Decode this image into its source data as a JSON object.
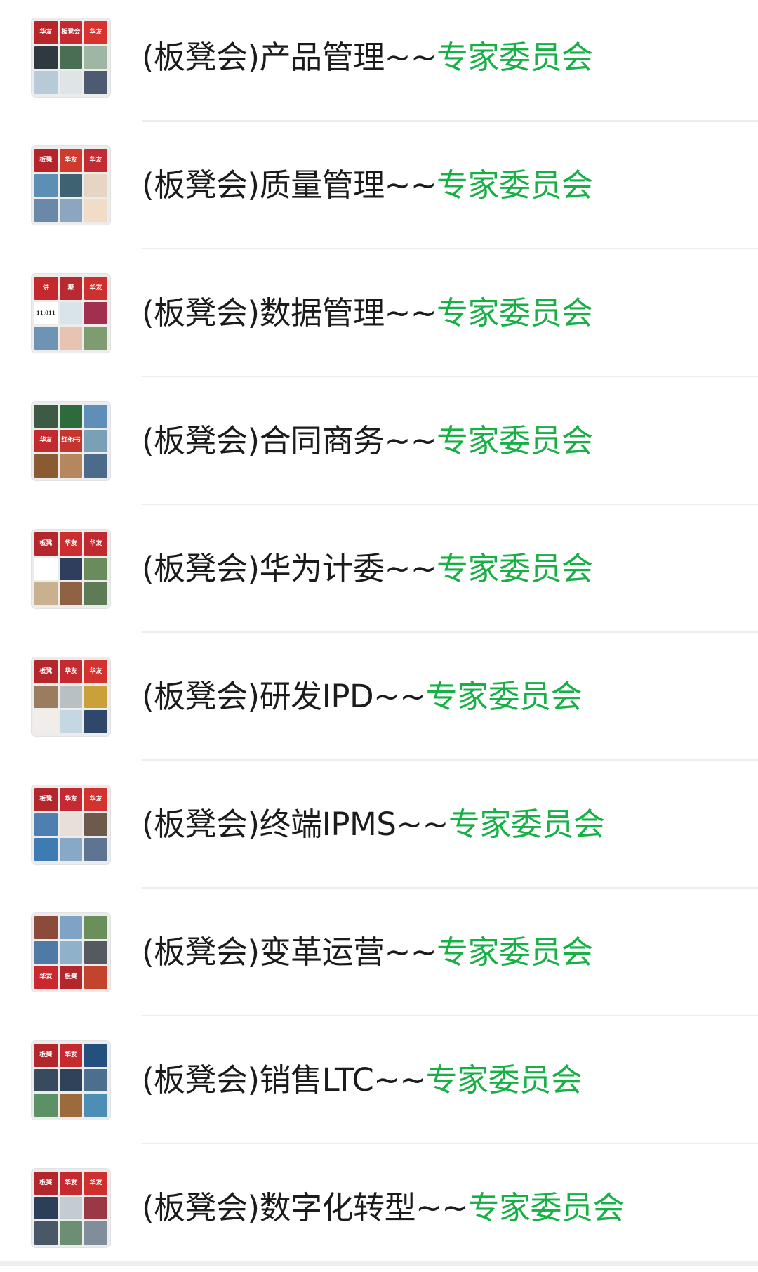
{
  "groups": [
    {
      "prefix": "(板凳会)产品管理~~",
      "suffix": "专家委员会"
    },
    {
      "prefix": "(板凳会)质量管理~~",
      "suffix": "专家委员会"
    },
    {
      "prefix": "(板凳会)数据管理~~",
      "suffix": "专家委员会"
    },
    {
      "prefix": "(板凳会)合同商务~~",
      "suffix": "专家委员会"
    },
    {
      "prefix": "(板凳会)华为计委~~",
      "suffix": "专家委员会"
    },
    {
      "prefix": "(板凳会)研发IPD~~",
      "suffix": "专家委员会"
    },
    {
      "prefix": "(板凳会)终端IPMS~~",
      "suffix": "专家委员会"
    },
    {
      "prefix": "(板凳会)变革运营~~",
      "suffix": "专家委员会"
    },
    {
      "prefix": "(板凳会)销售LTC~~",
      "suffix": "专家委员会"
    },
    {
      "prefix": "(板凳会)数字化转型~~",
      "suffix": "专家委员会"
    }
  ],
  "colors": {
    "title_text": "#1b1b1b",
    "accent_green": "#16b045",
    "divider": "#ececec",
    "avatar_bg": "#ececec"
  },
  "avatar_tiles": [
    [
      {
        "bg": "#b8252b",
        "text": "华友"
      },
      {
        "bg": "#c42a30",
        "text": "板凳会"
      },
      {
        "bg": "#d8342f",
        "text": "华友"
      },
      {
        "bg": "#2e3a3f"
      },
      {
        "bg": "#4a6e54"
      },
      {
        "bg": "#9fb6a4"
      },
      {
        "bg": "#b6cad8"
      },
      {
        "bg": "#dfe4e6"
      },
      {
        "bg": "#4d5b71"
      }
    ],
    [
      {
        "bg": "#b4242a",
        "text": "板凳"
      },
      {
        "bg": "#d03a2c",
        "text": "华友"
      },
      {
        "bg": "#c12b33",
        "text": "华友"
      },
      {
        "bg": "#5b8fb3"
      },
      {
        "bg": "#3f6272"
      },
      {
        "bg": "#e7d5c3"
      },
      {
        "bg": "#6a88a8"
      },
      {
        "bg": "#8da6bf"
      },
      {
        "bg": "#f1dcc8"
      }
    ],
    [
      {
        "bg": "#c5282d",
        "text": "讲"
      },
      {
        "bg": "#b82a2f",
        "text": "聚"
      },
      {
        "bg": "#cc3130",
        "text": "华友"
      },
      {
        "bg": "#ffffff",
        "text": "11,011"
      },
      {
        "bg": "#d9e4ea"
      },
      {
        "bg": "#a0304d"
      },
      {
        "bg": "#6f93b3"
      },
      {
        "bg": "#e7c3b2"
      },
      {
        "bg": "#7e9b72"
      }
    ],
    [
      {
        "bg": "#3d5a44"
      },
      {
        "bg": "#2f6a3c"
      },
      {
        "bg": "#5f8fb8"
      },
      {
        "bg": "#c22a2f",
        "text": "华友"
      },
      {
        "bg": "#c43530",
        "text": "红他书"
      },
      {
        "bg": "#7aa0b8"
      },
      {
        "bg": "#8a5a33"
      },
      {
        "bg": "#b6865c"
      },
      {
        "bg": "#4c6a8a"
      }
    ],
    [
      {
        "bg": "#b3262c",
        "text": "板凳"
      },
      {
        "bg": "#cc2e2f",
        "text": "华友"
      },
      {
        "bg": "#bf2a31",
        "text": "华友"
      },
      {
        "bg": "#ffffff"
      },
      {
        "bg": "#2e3e5c"
      },
      {
        "bg": "#6a8b5a"
      },
      {
        "bg": "#c9b08f"
      },
      {
        "bg": "#8e6243"
      },
      {
        "bg": "#5d7b54"
      }
    ],
    [
      {
        "bg": "#b3262c",
        "text": "板凳"
      },
      {
        "bg": "#c42a30",
        "text": "华友"
      },
      {
        "bg": "#d3332f",
        "text": "华友"
      },
      {
        "bg": "#9a7d5e"
      },
      {
        "bg": "#b8c0c4"
      },
      {
        "bg": "#caa03a"
      },
      {
        "bg": "#f1eee9"
      },
      {
        "bg": "#c5d7e3"
      },
      {
        "bg": "#2f4869"
      }
    ],
    [
      {
        "bg": "#b3262c",
        "text": "板凳"
      },
      {
        "bg": "#c42a30",
        "text": "华友"
      },
      {
        "bg": "#d3332f",
        "text": "华友"
      },
      {
        "bg": "#4e7fb0"
      },
      {
        "bg": "#e8e0d8"
      },
      {
        "bg": "#6e5a4c"
      },
      {
        "bg": "#3d7bb2"
      },
      {
        "bg": "#87a8c6"
      },
      {
        "bg": "#5e7491"
      }
    ],
    [
      {
        "bg": "#8b4b3a"
      },
      {
        "bg": "#7ea3c4"
      },
      {
        "bg": "#6b8f5a"
      },
      {
        "bg": "#4f7aa5"
      },
      {
        "bg": "#8fb1c9"
      },
      {
        "bg": "#565a60"
      },
      {
        "bg": "#c8282e",
        "text": "华友"
      },
      {
        "bg": "#b3262c",
        "text": "板凳"
      },
      {
        "bg": "#c2442c"
      }
    ],
    [
      {
        "bg": "#b3262c",
        "text": "板凳"
      },
      {
        "bg": "#c42a30",
        "text": "华友"
      },
      {
        "bg": "#24507e"
      },
      {
        "bg": "#394a5e"
      },
      {
        "bg": "#30415a"
      },
      {
        "bg": "#4d6f8e"
      },
      {
        "bg": "#5b9165"
      },
      {
        "bg": "#9b6b3c"
      },
      {
        "bg": "#4c8eb6"
      }
    ],
    [
      {
        "bg": "#b3262c",
        "text": "板凳"
      },
      {
        "bg": "#c42a30",
        "text": "华友"
      },
      {
        "bg": "#cf302e",
        "text": "华友"
      },
      {
        "bg": "#2d3f58"
      },
      {
        "bg": "#c3ccd3"
      },
      {
        "bg": "#9b3846"
      },
      {
        "bg": "#485866"
      },
      {
        "bg": "#6c8f73"
      },
      {
        "bg": "#7f8e9a"
      }
    ]
  ]
}
